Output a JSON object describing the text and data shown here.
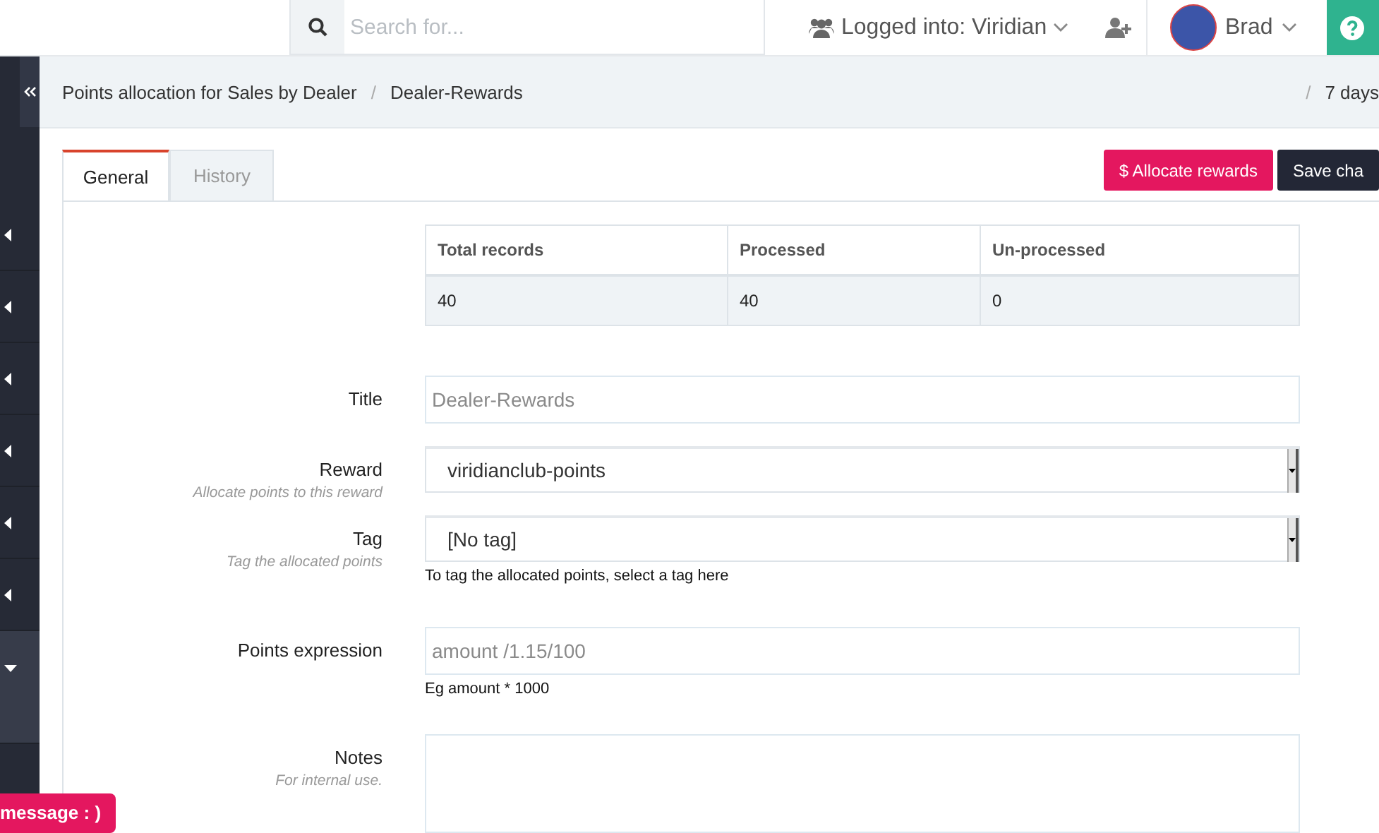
{
  "topbar": {
    "search": {
      "placeholder": "Search for..."
    },
    "account": "Logged into: Viridian",
    "user": "Brad"
  },
  "sidebar": {
    "items": [
      {
        "expanded": false
      },
      {
        "expanded": false
      },
      {
        "expanded": false
      },
      {
        "expanded": false
      },
      {
        "expanded": false
      },
      {
        "expanded": false
      },
      {
        "expanded": true
      }
    ]
  },
  "breadcrumb": {
    "items": [
      "Points allocation for Sales by Dealer",
      "Dealer-Rewards"
    ],
    "separators": [
      "/",
      "/"
    ],
    "range": "7 days"
  },
  "tabs": [
    {
      "label": "General",
      "selected": true
    },
    {
      "label": "History",
      "selected": false
    }
  ],
  "buttons": [
    {
      "kind": "primary",
      "label": "$ Allocate rewards"
    },
    {
      "kind": "dark",
      "label": "Save cha"
    }
  ],
  "summary": {
    "columns": [
      "Total records",
      "Processed",
      "Un-processed"
    ],
    "rows": [
      [
        "40",
        "40",
        "0"
      ]
    ]
  },
  "form": [
    {
      "kind": "input",
      "label": "Title",
      "placeholder": "Dealer-Rewards"
    },
    {
      "kind": "select",
      "label": "Reward",
      "hint": "Allocate points to this reward",
      "value": "viridianclub-points"
    },
    {
      "kind": "select",
      "label": "Tag",
      "hint": "Tag the allocated points",
      "value": "[No tag]",
      "help": "To tag the allocated points, select a tag here"
    },
    {
      "kind": "input",
      "label": "Points expression",
      "placeholder": "amount /1.15/100",
      "help": "Eg amount * 1000"
    },
    {
      "kind": "textarea",
      "label": "Notes",
      "hint": "For internal use."
    }
  ],
  "chat": {
    "label": "message : )"
  }
}
